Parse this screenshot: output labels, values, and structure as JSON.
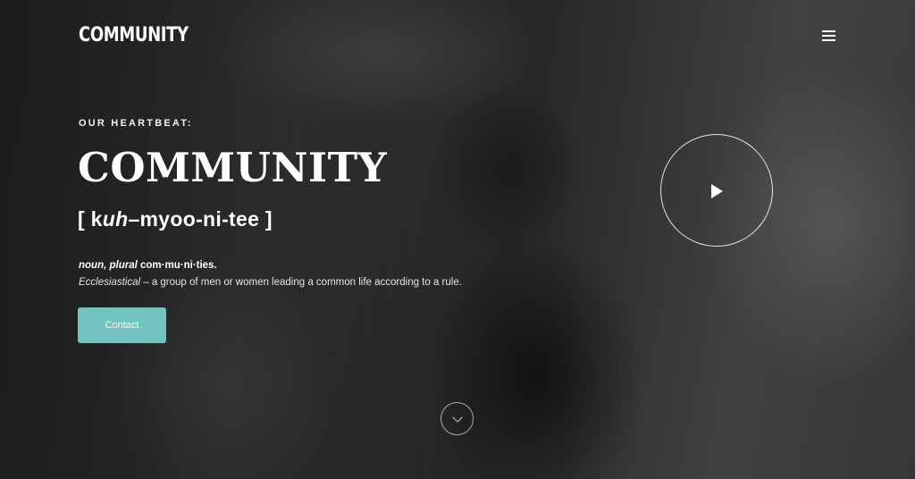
{
  "header": {
    "logo_text": "COMMUNITY",
    "menu_icon": "hamburger-menu-icon"
  },
  "hero": {
    "eyebrow": "OUR HEARTBEAT:",
    "headline": "COMMUNITY",
    "pronunciation": {
      "open": "[ k",
      "italic": "uh",
      "rest": "–myoo-ni-tee ]"
    },
    "definition": {
      "pos": "noun, plural",
      "plural": " com·mu·ni·ties.",
      "domain": "Ecclesiastical",
      "meaning": " – a group of men or women leading a common life according to a rule."
    },
    "contact_label": "Contact",
    "play_icon": "play-icon",
    "scroll_icon": "chevron-down-icon"
  },
  "colors": {
    "accent": "#72c3c1",
    "text": "#ffffff"
  }
}
